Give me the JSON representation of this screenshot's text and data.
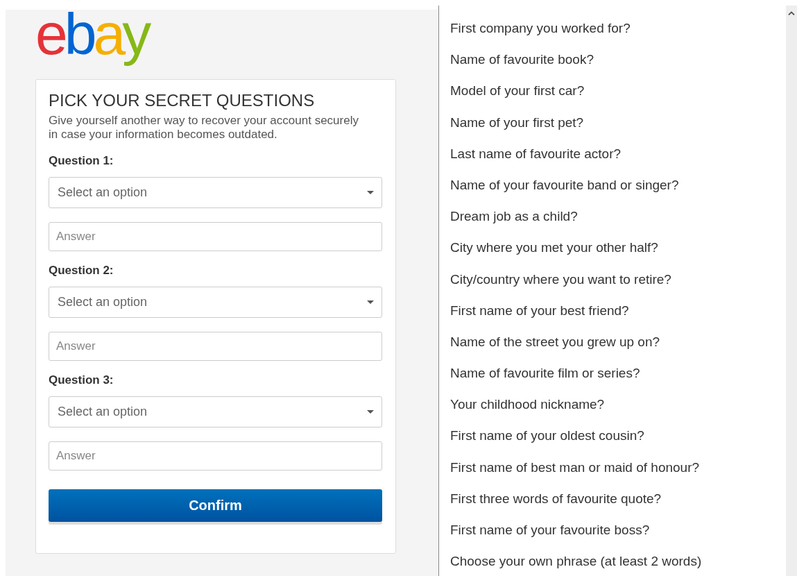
{
  "logo": "ebay",
  "form": {
    "title": "PICK YOUR SECRET QUESTIONS",
    "description": "Give yourself another way to recover your account securely in case your information becomes outdated.",
    "questions": [
      {
        "label": "Question 1:",
        "select_placeholder": "Select an option",
        "answer_placeholder": "Answer"
      },
      {
        "label": "Question 2:",
        "select_placeholder": "Select an option",
        "answer_placeholder": "Answer"
      },
      {
        "label": "Question 3:",
        "select_placeholder": "Select an option",
        "answer_placeholder": "Answer"
      }
    ],
    "confirm_button": "Confirm"
  },
  "dropdown_options": [
    {
      "label": "First company you worked for?",
      "selected": false
    },
    {
      "label": "Name of favourite book?",
      "selected": false
    },
    {
      "label": "Model of your first car?",
      "selected": false
    },
    {
      "label": "Name of your first pet?",
      "selected": false
    },
    {
      "label": "Last name of favourite actor?",
      "selected": false
    },
    {
      "label": "Name of your favourite band or singer?",
      "selected": false
    },
    {
      "label": "Dream job as a child?",
      "selected": false
    },
    {
      "label": "City where you met your other half?",
      "selected": false
    },
    {
      "label": "City/country where you want to retire?",
      "selected": false
    },
    {
      "label": "First name of your best friend?",
      "selected": false
    },
    {
      "label": "Name of the street you grew up on?",
      "selected": false
    },
    {
      "label": "Name of favourite film or series?",
      "selected": false
    },
    {
      "label": "Your childhood nickname?",
      "selected": false
    },
    {
      "label": "First name of your oldest cousin?",
      "selected": false
    },
    {
      "label": "First name of best man or maid of honour?",
      "selected": false
    },
    {
      "label": "First three words of favourite quote?",
      "selected": false
    },
    {
      "label": "First name of your favourite boss?",
      "selected": false
    },
    {
      "label": "Choose your own phrase (at least 2 words)",
      "selected": false
    }
  ]
}
